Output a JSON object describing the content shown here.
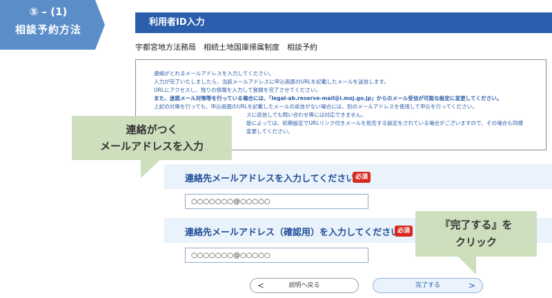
{
  "step": {
    "number": "⑤ – (1)",
    "title": "相談予約方法"
  },
  "header": {
    "title": "利用者ID入力"
  },
  "breadcrumb": "宇都宮地方法務局　相続土地国庫帰属制度　相談予約",
  "notice": {
    "lines": [
      "連絡がとれるメールアドレスを入力してください。",
      "入力が完了いたしましたら、当該メールアドレスに申込画面のURLを記載したメールを送信します。",
      "URLにアクセスし、残りの情報を入力して登録を完了させてください。",
      "また、迷惑メール対策等を行っている場合には、「legal-ab.reserve-mail@i.moj.go.jp」からのメール受信が可能な設定に変更してください。",
      "上記の対策を行っても、申込画面のURLを記載したメールの返信がない場合には、別のメールアドレスを使用して申込を行ってください。",
      "スに返信しても問い合わせ等には対応できません。",
      "能によっては、初期設定でURLリンク付きメールを拒否する設定をされている場合がございますので、その場合も同様",
      "変更してください。"
    ]
  },
  "form": {
    "email_label": "連絡先メールアドレスを入力してください",
    "email_confirm_label": "連絡先メールアドレス（確認用）を入力してください",
    "required_badge": "必須",
    "email_value": "○○○○○○○@○○○○○",
    "email_confirm_value": "○○○○○○○@○○○○○"
  },
  "buttons": {
    "back_label": "説明へ戻る",
    "back_chevron": "<",
    "done_label": "完了する",
    "done_chevron": ">"
  },
  "callouts": {
    "email_line1": "連絡がつく",
    "email_line2": "メールアドレスを入力",
    "done_line1": "『完了する』を",
    "done_line2": "クリック"
  },
  "colors": {
    "header_blue": "#2b5fae",
    "badge_blue": "#5b8ec9",
    "required_red": "#d9281e",
    "callout_green": "#c9ddb8"
  }
}
